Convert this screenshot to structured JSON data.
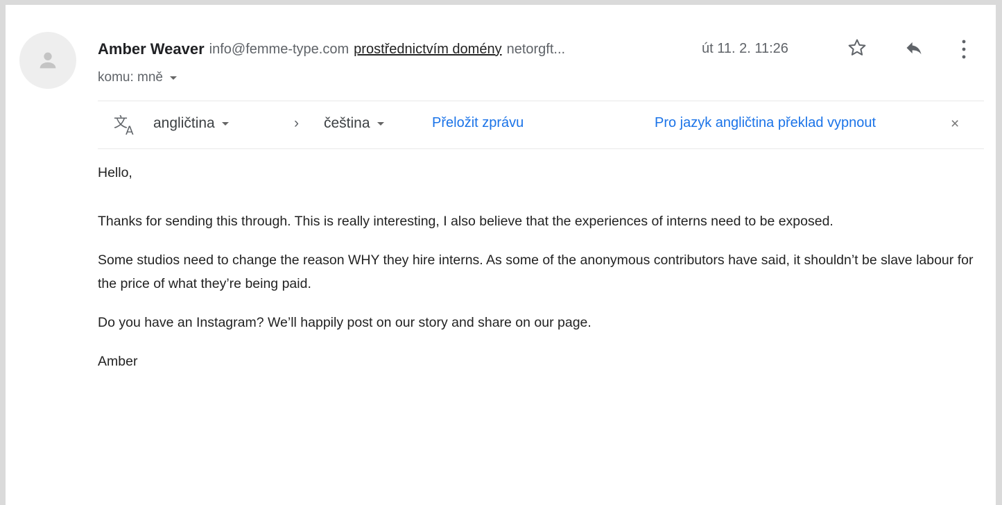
{
  "sender": {
    "name": "Amber Weaver",
    "email": "info@femme-type.com",
    "via_label": "prostřednictvím domény",
    "via_domain": "netorgft...",
    "date": "út 11. 2. 11:26"
  },
  "recipient": {
    "label": "komu: mně"
  },
  "translate": {
    "source_lang": "angličtina",
    "separator": "›",
    "target_lang": "čeština",
    "translate_link": "Přeložit zprávu",
    "turn_off_link": "Pro jazyk angličtina překlad vypnout",
    "close": "×"
  },
  "message": {
    "greeting": "Hello,",
    "paragraphs": [
      "Thanks for sending this through. This is really interesting, I also believe that the experiences of interns need to be exposed.",
      "Some studios need to change the reason WHY they hire interns. As some of the anonymous contributors have said, it shouldn’t be slave labour for the price of what they’re being paid.",
      "Do you have an Instagram? We’ll happily post on our story and share on our page."
    ],
    "signature": "Amber"
  },
  "icons": {
    "avatar": "person-icon",
    "star": "star-outline-icon",
    "reply": "reply-icon",
    "more": "more-vert-icon",
    "translate": "translate-icon",
    "dropdown": "caret-down-icon",
    "close": "close-icon"
  },
  "colors": {
    "link": "#1a73e8",
    "muted": "#5f6368",
    "text": "#222222",
    "avatar_bg": "#eeeeee"
  }
}
